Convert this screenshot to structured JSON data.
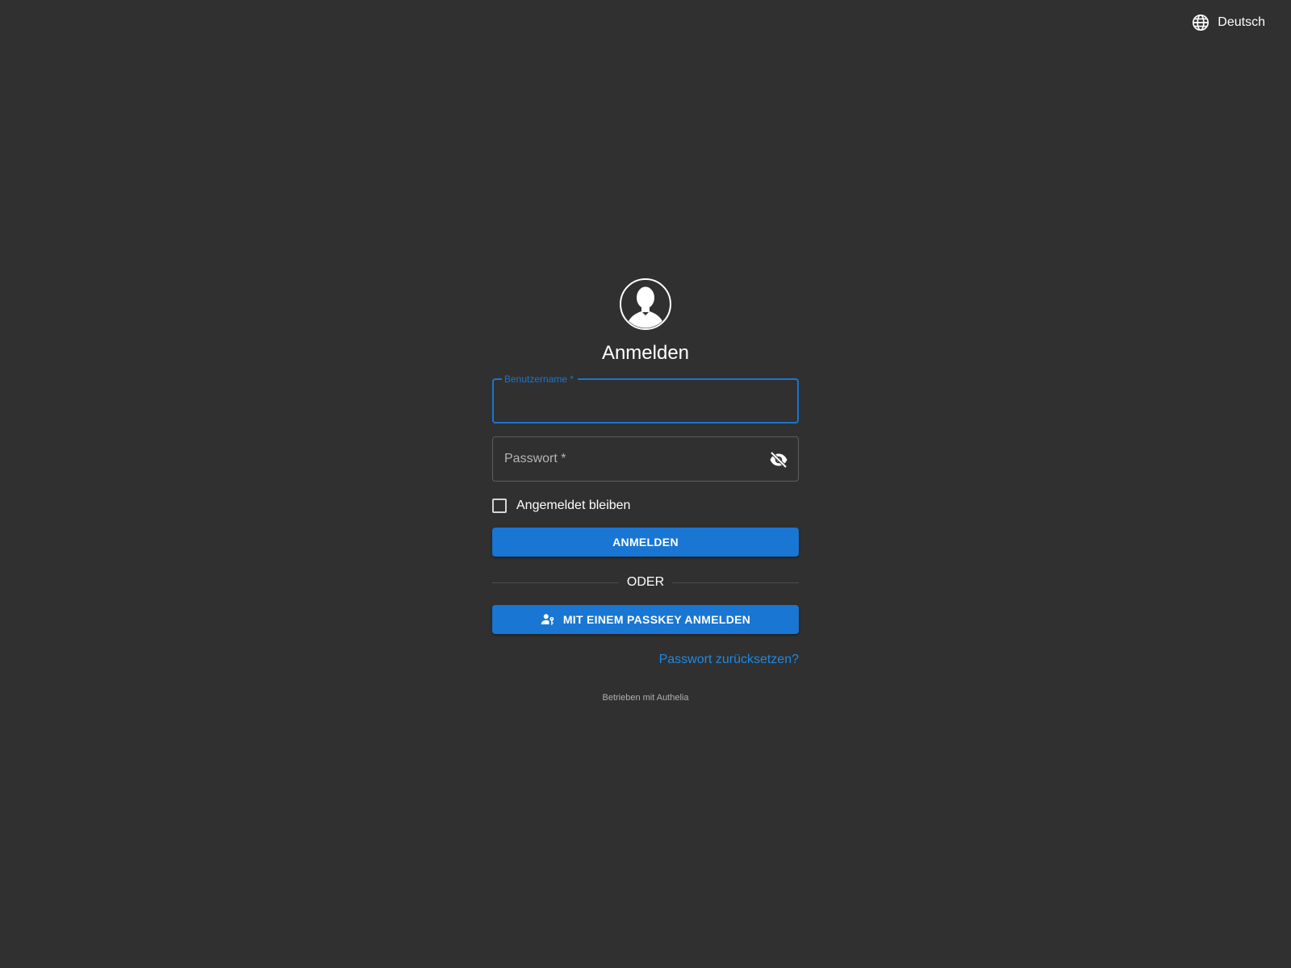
{
  "header": {
    "language": "Deutsch",
    "language_icon": "globe-icon"
  },
  "login": {
    "avatar_icon": "user-avatar-icon",
    "title": "Anmelden",
    "username": {
      "label": "Benutzername *",
      "value": ""
    },
    "password": {
      "placeholder": "Passwort *",
      "value": "",
      "toggle_icon": "eye-off-icon"
    },
    "remember_me": {
      "label": "Angemeldet bleiben",
      "checked": false
    },
    "signin_button": "ANMELDEN",
    "divider_text": "ODER",
    "passkey_button": "MIT EINEM PASSKEY ANMELDEN",
    "passkey_icon": "passkey-icon",
    "reset_password": "Passwort zurücksetzen?",
    "powered_by": "Betrieben mit Authelia"
  },
  "colors": {
    "background": "#303030",
    "primary": "#1976d2",
    "link": "#1e88e5",
    "text": "#ffffff"
  }
}
